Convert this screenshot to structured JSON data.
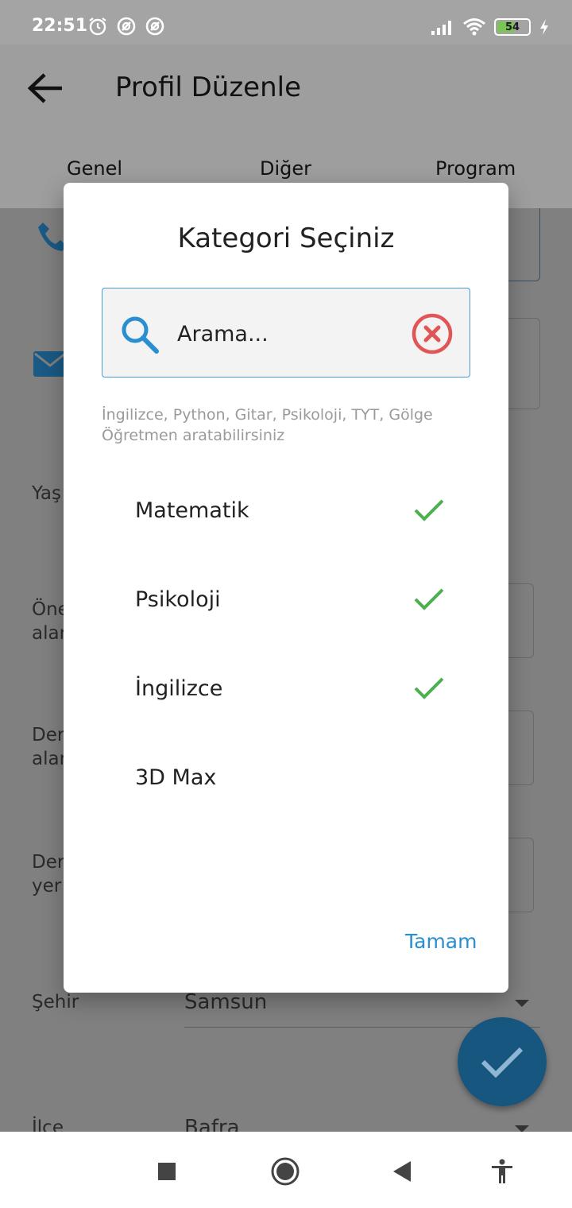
{
  "status_bar": {
    "time": "22:51",
    "battery": "54",
    "battery_level": 0.54,
    "icons_left": [
      "alarm-icon",
      "notification-icon",
      "notification-icon"
    ],
    "icons_right": [
      "signal-icon",
      "wifi-icon",
      "battery-icon",
      "charging-icon"
    ]
  },
  "app_bar": {
    "title": "Profil Düzenle",
    "back_icon": "arrow-left-icon",
    "tabs": [
      "Genel",
      "Diğer",
      "Program"
    ]
  },
  "background_form": {
    "labels": {
      "age": "Yaş",
      "prev_line1": "Öne",
      "prev_line2": "alar",
      "area_line1": "Der",
      "area_line2": "alar",
      "place_line1": "Der",
      "place_line2": "yer",
      "city": "Şehir",
      "district": "İlçe"
    },
    "city_value": "Samsun",
    "district_value": "Bafra"
  },
  "dialog": {
    "title": "Kategori Seçiniz",
    "search": {
      "placeholder": "Arama...",
      "value": ""
    },
    "hint": "İngilizce, Python, Gitar, Psikoloji, TYT, Gölge Öğretmen aratabilirsiniz",
    "categories": [
      {
        "label": "Matematik",
        "selected": true
      },
      {
        "label": "Psikoloji",
        "selected": true
      },
      {
        "label": "İngilizce",
        "selected": true
      },
      {
        "label": "3D Max",
        "selected": false
      }
    ],
    "ok_label": "Tamam"
  },
  "colors": {
    "accent": "#2a8fd0",
    "check": "#4caf50",
    "clear": "#e05555",
    "fab": "#16567f"
  },
  "fab_icon": "check-icon",
  "nav_bar": [
    "recents-button",
    "home-button",
    "back-button",
    "accessibility-button"
  ]
}
